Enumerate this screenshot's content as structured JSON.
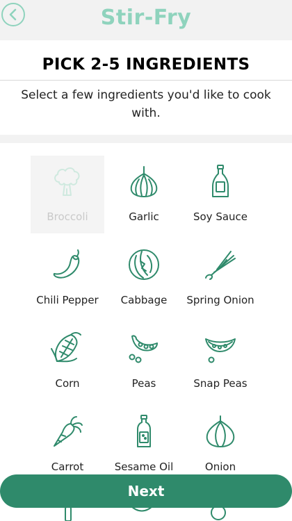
{
  "header": {
    "title": "Stir-Fry",
    "back_icon": "chevron-left-icon"
  },
  "intro": {
    "heading": "PICK 2-5 INGREDIENTS",
    "subtitle": "Select a few ingredients you'd like to cook with."
  },
  "ingredients": [
    {
      "label": "Broccoli",
      "icon": "broccoli-icon",
      "selected": true
    },
    {
      "label": "Garlic",
      "icon": "garlic-icon",
      "selected": false
    },
    {
      "label": "Soy Sauce",
      "icon": "soy-sauce-icon",
      "selected": false
    },
    {
      "label": "Chili Pepper",
      "icon": "chili-pepper-icon",
      "selected": false
    },
    {
      "label": "Cabbage",
      "icon": "cabbage-icon",
      "selected": false
    },
    {
      "label": "Spring Onion",
      "icon": "spring-onion-icon",
      "selected": false
    },
    {
      "label": "Corn",
      "icon": "corn-icon",
      "selected": false
    },
    {
      "label": "Peas",
      "icon": "peas-icon",
      "selected": false
    },
    {
      "label": "Snap Peas",
      "icon": "snap-peas-icon",
      "selected": false
    },
    {
      "label": "Carrot",
      "icon": "carrot-icon",
      "selected": false
    },
    {
      "label": "Sesame Oil",
      "icon": "sesame-oil-icon",
      "selected": false
    },
    {
      "label": "Onion",
      "icon": "onion-icon",
      "selected": false
    }
  ],
  "next_label": "Next",
  "colors": {
    "accent": "#8fd3bd",
    "icon": "#2f8a6b",
    "button": "#2f8a6b"
  }
}
